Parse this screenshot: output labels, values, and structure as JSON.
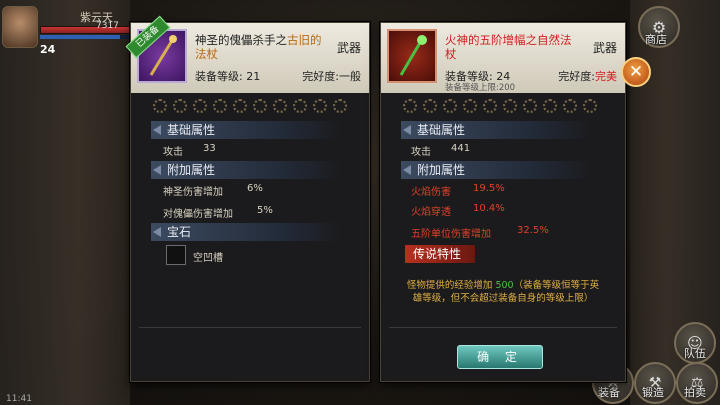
{
  "hud": {
    "player_name": "紫云天",
    "hp_text": "7317",
    "level": "24"
  },
  "side_menu": {
    "shop": "商店",
    "team": "队伍",
    "equipment": "装备",
    "forge": "锻造",
    "auction": "拍卖"
  },
  "left_item": {
    "equipped_tag": "已装备",
    "title_prefix": "神圣的傀儡杀手之",
    "title_highlight": "古旧的",
    "title_suffix": "法杖",
    "type": "武器",
    "level_label": "装备等级: 21",
    "condition_label": "完好度:",
    "condition_value": "一般",
    "gem_slots": 10,
    "sections": {
      "basic": "基础属性",
      "extra": "附加属性",
      "gem": "宝石"
    },
    "basic_stats": [
      {
        "name": "攻击",
        "value": "33"
      }
    ],
    "extra_stats": [
      {
        "name": "神圣伤害增加",
        "value": "6%"
      },
      {
        "name": "对傀儡伤害增加",
        "value": "5%"
      }
    ],
    "gem_empty": "空凹槽"
  },
  "right_item": {
    "title": "火神的五阶增幅之自然法杖",
    "type": "武器",
    "level_label": "装备等级: 24",
    "condition_label": "完好度:",
    "condition_value": "完美",
    "level_cap": "装备等级上限:200",
    "gem_slots": 10,
    "sections": {
      "basic": "基础属性",
      "extra": "附加属性",
      "legend": "传说特性"
    },
    "basic_stats": [
      {
        "name": "攻击",
        "value": "441"
      }
    ],
    "extra_stats": [
      {
        "name": "火焰伤害",
        "value": "19.5%"
      },
      {
        "name": "火焰穿透",
        "value": "10.4%"
      },
      {
        "name": "五阶单位伤害增加",
        "value": "32.5%"
      }
    ],
    "legend_desc_1": "怪物提供的经验增加 ",
    "legend_desc_value": "500",
    "legend_desc_2": "（装备等级恒等于英雄等级，但不会超过装备自身的等级上限）",
    "confirm": "确 定"
  },
  "status": {
    "time": "11:41"
  },
  "colors": {
    "equipped": "#2f8a2f",
    "legend": "#b83020",
    "stat_red": "#e04028",
    "gold_text": "#e0b040"
  }
}
